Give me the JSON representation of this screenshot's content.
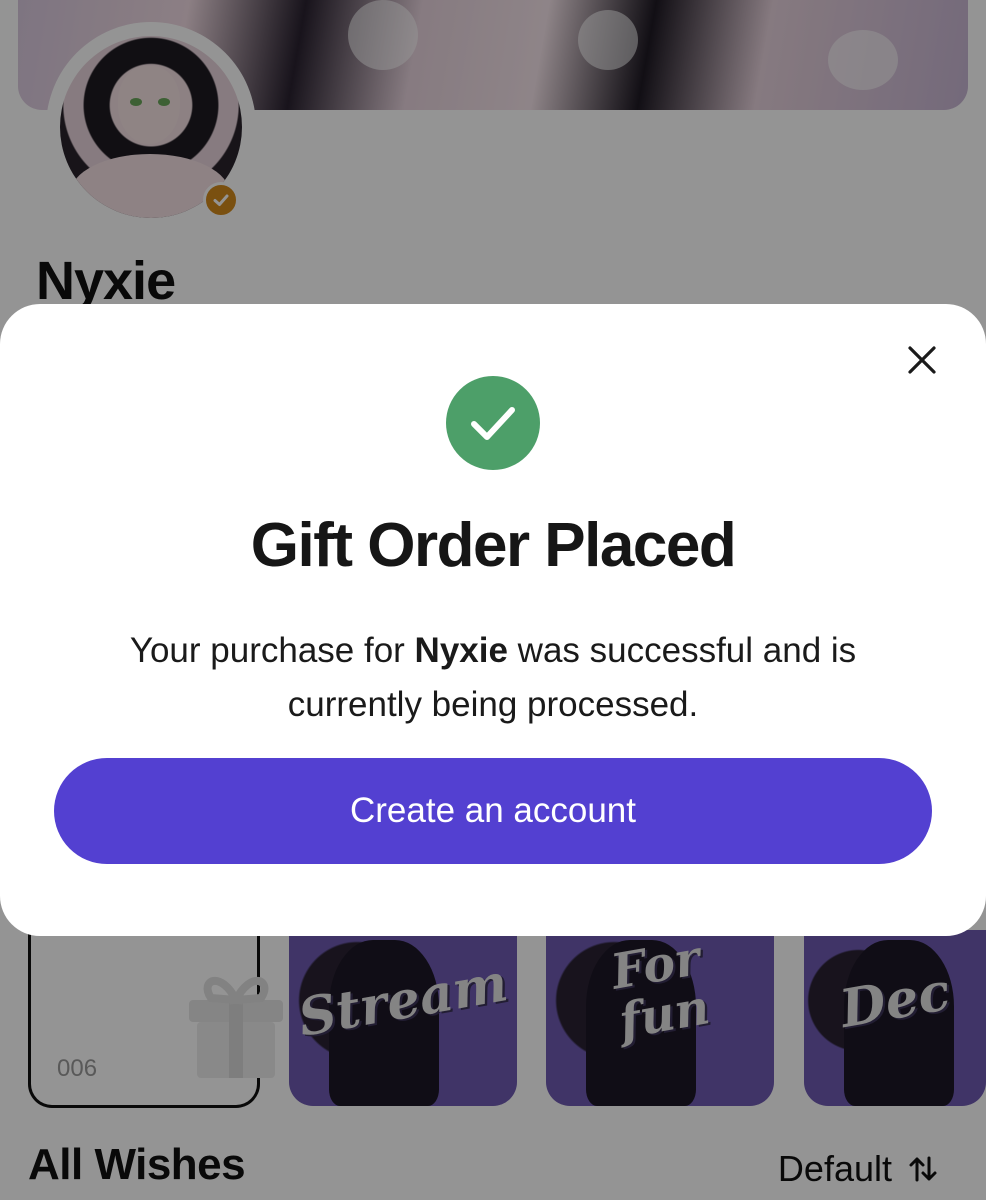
{
  "profile": {
    "name": "Nyxie",
    "verified_icon": "verified-badge-icon"
  },
  "wishlist": {
    "empty_tile_count": "006",
    "tiles": [
      {
        "label_line1": "Stream",
        "label_line2": ""
      },
      {
        "label_line1": "For",
        "label_line2": "fun"
      },
      {
        "label_line1": "Dec",
        "label_line2": ""
      }
    ],
    "section_title": "All Wishes",
    "sort_label": "Default",
    "sort_icon": "sort-arrows-icon"
  },
  "modal": {
    "close_icon": "close-icon",
    "success_icon": "check-circle-icon",
    "title": "Gift Order Placed",
    "message_prefix": "Your purchase for ",
    "message_name": "Nyxie",
    "message_suffix": " was successful and is currently being processed.",
    "cta_label": "Create an account"
  },
  "colors": {
    "accent": "#5340d1",
    "success": "#4d9f69",
    "verified": "#d28a1c"
  }
}
